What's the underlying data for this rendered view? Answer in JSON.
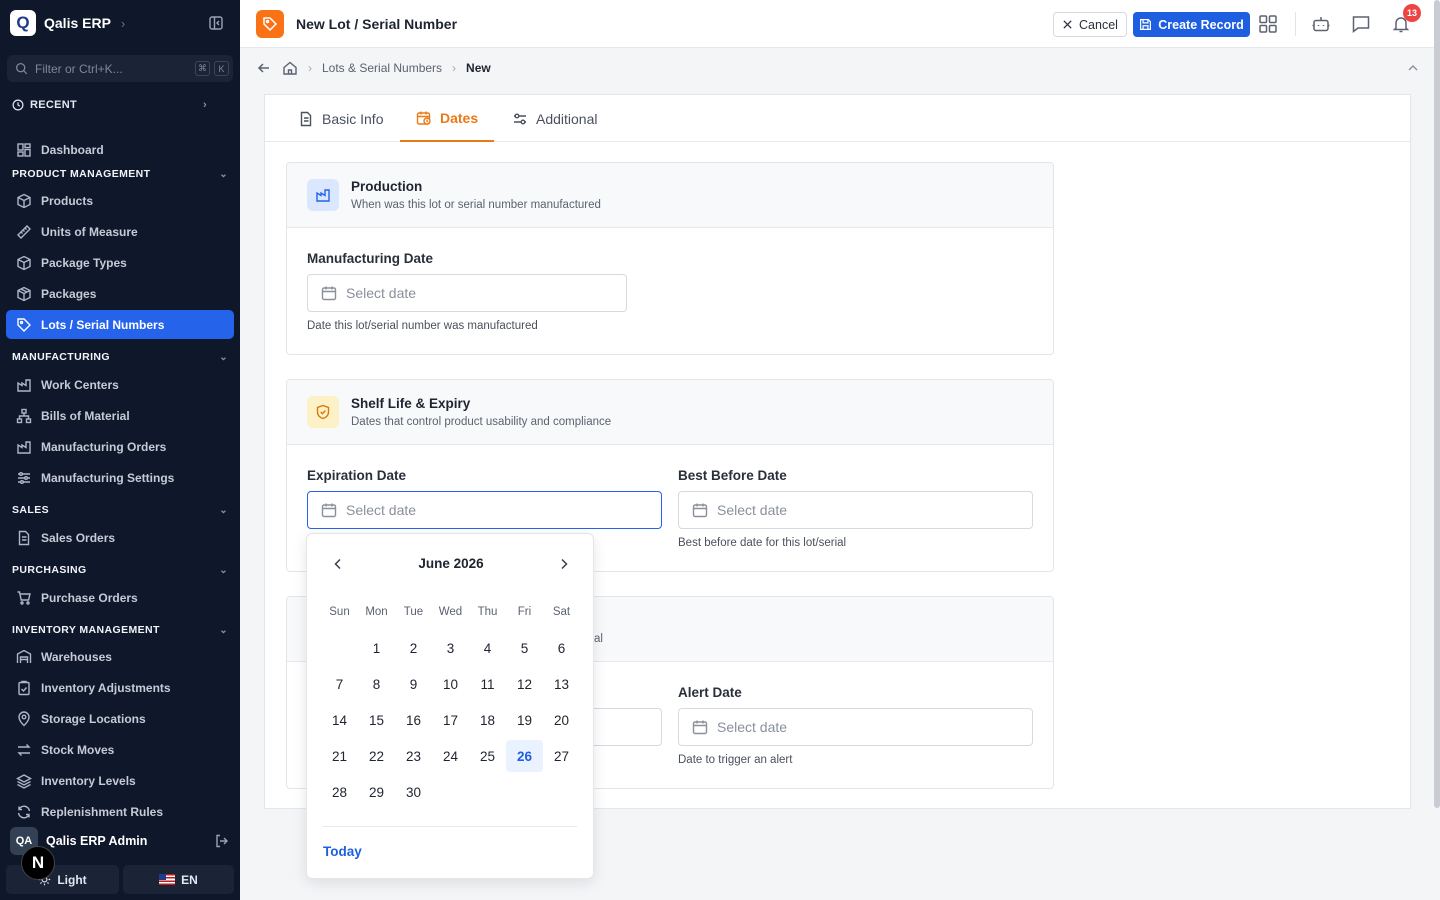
{
  "sidebar": {
    "brand": {
      "logo_letter": "Q",
      "name": "Qalis ERP"
    },
    "filter": {
      "placeholder": "Filter or Ctrl+K...",
      "kbd1": "⌘",
      "kbd2": "K"
    },
    "recent": "RECENT",
    "dashboard": "Dashboard",
    "sections": [
      {
        "title": "PRODUCT MANAGEMENT",
        "items": [
          "Products",
          "Units of Measure",
          "Package Types",
          "Packages",
          "Lots / Serial Numbers"
        ]
      },
      {
        "title": "MANUFACTURING",
        "items": [
          "Work Centers",
          "Bills of Material",
          "Manufacturing Orders",
          "Manufacturing Settings"
        ]
      },
      {
        "title": "SALES",
        "items": [
          "Sales Orders"
        ]
      },
      {
        "title": "PURCHASING",
        "items": [
          "Purchase Orders"
        ]
      },
      {
        "title": "INVENTORY MANAGEMENT",
        "items": [
          "Warehouses",
          "Inventory Adjustments",
          "Storage Locations",
          "Stock Moves",
          "Inventory Levels",
          "Replenishment Rules"
        ]
      }
    ],
    "active_item": "Lots / Serial Numbers",
    "user": {
      "initials": "QA",
      "name": "Qalis ERP Admin"
    },
    "theme_label": "Light",
    "lang_label": "EN",
    "next_badge": "N"
  },
  "header": {
    "title": "New Lot / Serial Number",
    "cancel_label": "Cancel",
    "create_label": "Create Record",
    "notification_count": "13",
    "icons": [
      "apps-grid-icon",
      "bot-icon",
      "chat-icon",
      "bell-icon"
    ]
  },
  "breadcrumb": {
    "items": [
      "Lots & Serial Numbers"
    ],
    "current": "New"
  },
  "tabs": [
    {
      "label": "Basic Info",
      "icon": "document-icon"
    },
    {
      "label": "Dates",
      "icon": "calendar-clock-icon",
      "active": true
    },
    {
      "label": "Additional",
      "icon": "sliders-icon"
    }
  ],
  "sections": {
    "production": {
      "title": "Production",
      "description": "When was this lot or serial number manufactured",
      "mfg_label": "Manufacturing Date",
      "mfg_placeholder": "Select date",
      "mfg_hint": "Date this lot/serial number was manufactured"
    },
    "shelf": {
      "title": "Shelf Life & Expiry",
      "description": "Dates that control product usability and compliance",
      "exp_label": "Expiration Date",
      "exp_placeholder": "Select date",
      "bb_label": "Best Before Date",
      "bb_placeholder": "Select date",
      "bb_hint": "Best before date for this lot/serial"
    },
    "third": {
      "description_fragment": "al",
      "alert_label": "Alert Date",
      "alert_placeholder": "Select date",
      "alert_hint": "Date to trigger an alert"
    }
  },
  "calendar": {
    "month": "June 2026",
    "weekdays": [
      "Sun",
      "Mon",
      "Tue",
      "Wed",
      "Thu",
      "Fri",
      "Sat"
    ],
    "first_weekday_index": 1,
    "days_in_month": 30,
    "today": 26,
    "today_label": "Today"
  },
  "colors": {
    "accent": "#1d5fe0",
    "brand_orange": "#f97316",
    "sidebar_bg": "#0f172a",
    "active_tab": "#ea7a17"
  }
}
